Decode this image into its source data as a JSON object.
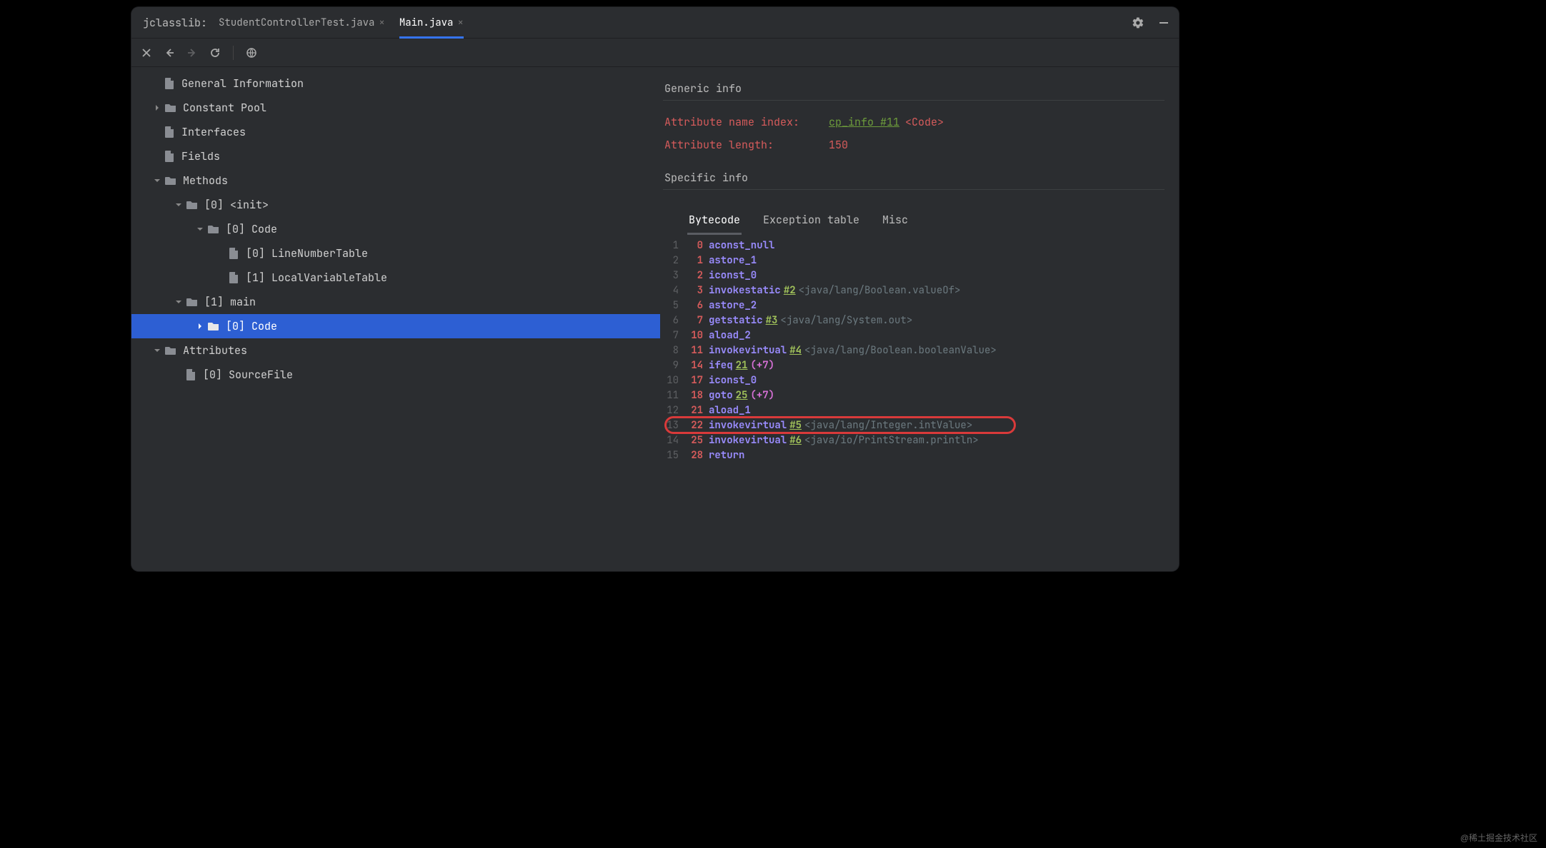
{
  "title": "jclasslib:",
  "tabs": [
    {
      "label": "StudentControllerTest.java",
      "active": false
    },
    {
      "label": "Main.java",
      "active": true
    }
  ],
  "tree": [
    {
      "indent": 0,
      "chev": "",
      "icon": "file",
      "label": "General Information",
      "selected": false
    },
    {
      "indent": 0,
      "chev": "right",
      "icon": "folder",
      "label": "Constant Pool",
      "selected": false
    },
    {
      "indent": 0,
      "chev": "",
      "icon": "file",
      "label": "Interfaces",
      "selected": false
    },
    {
      "indent": 0,
      "chev": "",
      "icon": "file",
      "label": "Fields",
      "selected": false
    },
    {
      "indent": 0,
      "chev": "down",
      "icon": "folder",
      "label": "Methods",
      "selected": false
    },
    {
      "indent": 1,
      "chev": "down",
      "icon": "folder",
      "label": "[0] <init>",
      "selected": false
    },
    {
      "indent": 2,
      "chev": "down",
      "icon": "folder",
      "label": "[0] Code",
      "selected": false
    },
    {
      "indent": 3,
      "chev": "",
      "icon": "file",
      "label": "[0] LineNumberTable",
      "selected": false
    },
    {
      "indent": 3,
      "chev": "",
      "icon": "file",
      "label": "[1] LocalVariableTable",
      "selected": false
    },
    {
      "indent": 1,
      "chev": "down",
      "icon": "folder",
      "label": "[1] main",
      "selected": false
    },
    {
      "indent": 2,
      "chev": "right",
      "icon": "folder",
      "label": "[0] Code",
      "selected": true
    },
    {
      "indent": 0,
      "chev": "down",
      "icon": "folder",
      "label": "Attributes",
      "selected": false
    },
    {
      "indent": 1,
      "chev": "",
      "icon": "file",
      "label": "[0] SourceFile",
      "selected": false
    }
  ],
  "detail": {
    "generic_title": "Generic info",
    "attr_name_label": "Attribute name index:",
    "attr_name_link": "cp_info #11",
    "attr_name_tag": "<Code>",
    "attr_len_label": "Attribute length:",
    "attr_len_value": "150",
    "specific_title": "Specific info",
    "code_tabs": [
      "Bytecode",
      "Exception table",
      "Misc"
    ],
    "active_code_tab": 0,
    "bytecode": [
      {
        "n": "1",
        "pc": "0",
        "op": "aconst_null",
        "ref": "",
        "tail": "",
        "mag": ""
      },
      {
        "n": "2",
        "pc": "1",
        "op": "astore_1",
        "ref": "",
        "tail": "",
        "mag": ""
      },
      {
        "n": "3",
        "pc": "2",
        "op": "iconst_0",
        "ref": "",
        "tail": "",
        "mag": ""
      },
      {
        "n": "4",
        "pc": "3",
        "op": "invokestatic",
        "ref": "#2",
        "tail": "<java/lang/Boolean.valueOf>",
        "mag": ""
      },
      {
        "n": "5",
        "pc": "6",
        "op": "astore_2",
        "ref": "",
        "tail": "",
        "mag": ""
      },
      {
        "n": "6",
        "pc": "7",
        "op": "getstatic",
        "ref": "#3",
        "tail": "<java/lang/System.out>",
        "mag": ""
      },
      {
        "n": "7",
        "pc": "10",
        "op": "aload_2",
        "ref": "",
        "tail": "",
        "mag": ""
      },
      {
        "n": "8",
        "pc": "11",
        "op": "invokevirtual",
        "ref": "#4",
        "tail": "<java/lang/Boolean.booleanValue>",
        "mag": ""
      },
      {
        "n": "9",
        "pc": "14",
        "op": "ifeq",
        "ref": "21",
        "tail": "",
        "mag": "(+7)"
      },
      {
        "n": "10",
        "pc": "17",
        "op": "iconst_0",
        "ref": "",
        "tail": "",
        "mag": ""
      },
      {
        "n": "11",
        "pc": "18",
        "op": "goto",
        "ref": "25",
        "tail": "",
        "mag": "(+7)"
      },
      {
        "n": "12",
        "pc": "21",
        "op": "aload_1",
        "ref": "",
        "tail": "",
        "mag": ""
      },
      {
        "n": "13",
        "pc": "22",
        "op": "invokevirtual",
        "ref": "#5",
        "tail": "<java/lang/Integer.intValue>",
        "mag": "",
        "hl": true
      },
      {
        "n": "14",
        "pc": "25",
        "op": "invokevirtual",
        "ref": "#6",
        "tail": "<java/io/PrintStream.println>",
        "mag": ""
      },
      {
        "n": "15",
        "pc": "28",
        "op": "return",
        "ref": "",
        "tail": "",
        "mag": ""
      }
    ]
  },
  "watermark": "@稀土掘金技术社区"
}
